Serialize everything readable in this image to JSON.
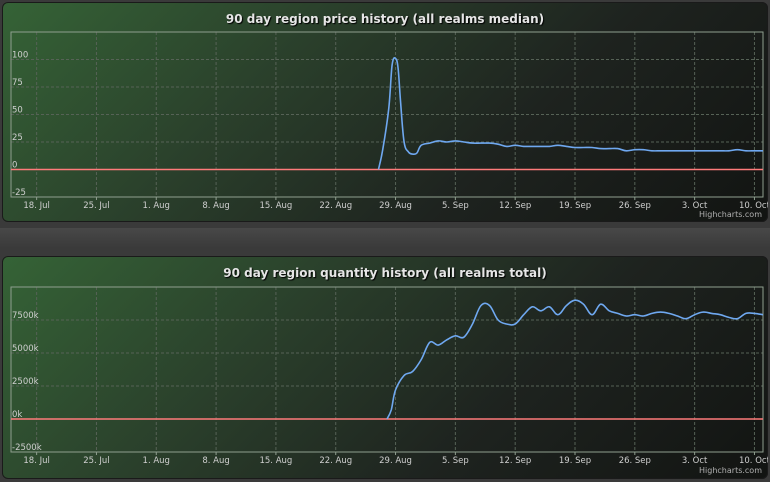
{
  "colors": {
    "series_line": "#6fa8f0",
    "zero_line": "#ff7b7b",
    "grid": "#566256",
    "plot_border": "#8f9f8f"
  },
  "credit": "Highcharts.com",
  "chart_data": [
    {
      "type": "line",
      "title": "90 day region price history (all realms median)",
      "xlabel": "",
      "ylabel": "",
      "x_tick_labels": [
        "18. Jul",
        "25. Jul",
        "1. Aug",
        "8. Aug",
        "15. Aug",
        "22. Aug",
        "29. Aug",
        "5. Sep",
        "12. Sep",
        "19. Sep",
        "26. Sep",
        "3. Oct",
        "10. Oct"
      ],
      "y_tick_labels": [
        "100",
        "75",
        "50",
        "25",
        "0",
        "-25"
      ],
      "y_ticks": [
        100,
        75,
        50,
        25,
        0,
        -25
      ],
      "ylim": [
        -25,
        125
      ],
      "xlim": [
        -3,
        85
      ],
      "zero_line": 0,
      "grid": true,
      "legend": "none",
      "series": [
        {
          "x": [
            40,
            40.5,
            41.2,
            41.6,
            42,
            42.3,
            42.6,
            43,
            43.5,
            44,
            44.5,
            45,
            46,
            47,
            48,
            49,
            50,
            51,
            52,
            53,
            54,
            55,
            56,
            57,
            58,
            59,
            60,
            61,
            62,
            63,
            64,
            65,
            66,
            67,
            68,
            69,
            70,
            71,
            72,
            73,
            74,
            75,
            76,
            77,
            78,
            79,
            80,
            81,
            82,
            83,
            84,
            85
          ],
          "y": [
            0,
            18,
            55,
            95,
            101,
            92,
            60,
            25,
            16,
            14,
            15,
            22,
            24,
            26,
            25,
            26,
            25,
            24,
            24,
            24,
            23,
            21,
            22,
            21,
            21,
            21,
            21,
            22,
            21,
            20,
            20,
            20,
            19,
            19,
            19,
            17,
            18,
            18,
            17,
            17,
            17,
            17,
            17,
            17,
            17,
            17,
            17,
            17,
            18,
            17,
            17,
            17
          ]
        }
      ]
    },
    {
      "type": "line",
      "title": "90 day region quantity history (all realms total)",
      "xlabel": "",
      "ylabel": "",
      "x_tick_labels": [
        "18. Jul",
        "25. Jul",
        "1. Aug",
        "8. Aug",
        "15. Aug",
        "22. Aug",
        "29. Aug",
        "5. Sep",
        "12. Sep",
        "19. Sep",
        "26. Sep",
        "3. Oct",
        "10. Oct"
      ],
      "y_tick_labels": [
        "7500k",
        "5000k",
        "2500k",
        "0k",
        "-2500k"
      ],
      "y_ticks": [
        7500,
        5000,
        2500,
        0,
        -2500
      ],
      "ylim": [
        -2500,
        10000
      ],
      "xlim": [
        -3,
        85
      ],
      "zero_line": 0,
      "grid": true,
      "legend": "none",
      "series": [
        {
          "x": [
            41,
            41.5,
            42,
            43,
            44,
            45,
            46,
            47,
            48,
            49,
            50,
            51,
            52,
            53,
            54,
            55,
            56,
            57,
            58,
            59,
            60,
            61,
            62,
            63,
            64,
            65,
            66,
            67,
            68,
            69,
            70,
            71,
            72,
            73,
            74,
            75,
            76,
            77,
            78,
            79,
            80,
            81,
            82,
            83,
            84,
            85
          ],
          "y": [
            0,
            700,
            2200,
            3300,
            3600,
            4500,
            5800,
            5600,
            6000,
            6300,
            6200,
            7200,
            8600,
            8600,
            7500,
            7200,
            7200,
            7900,
            8500,
            8200,
            8500,
            7900,
            8600,
            9000,
            8700,
            7900,
            8700,
            8200,
            8000,
            7800,
            7900,
            7800,
            8000,
            8100,
            8000,
            7800,
            7600,
            7900,
            8100,
            8000,
            7900,
            7700,
            7600,
            8000,
            8000,
            7900
          ]
        }
      ]
    }
  ]
}
